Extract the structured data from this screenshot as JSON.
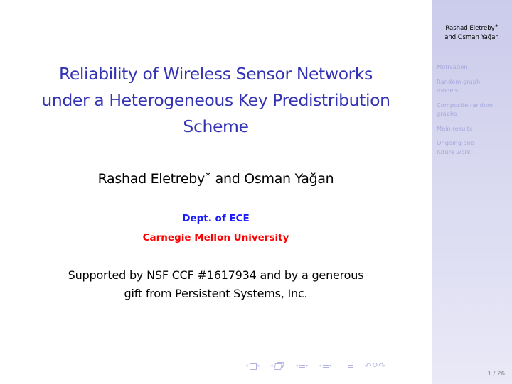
{
  "slide": {
    "title_lines": [
      "Reliability of Wireless Sensor Networks",
      "under a Heterogeneous Key Predistribution",
      "Scheme"
    ],
    "authors": {
      "first": "Rashad Eletreby",
      "first_mark": "∗",
      "connector": " and ",
      "second": "Osman Yağan"
    },
    "department": "Dept. of ECE",
    "university": "Carnegie Mellon University",
    "support_lines": [
      "Supported by NSF CCF #1617934 and by a generous",
      "gift from Persistent Systems, Inc."
    ],
    "colors": {
      "title": "#3333b3",
      "department": "#1a1aff",
      "university": "#ff0000"
    }
  },
  "sidebar": {
    "author_line1": "Rashad Eletreby",
    "author_mark": "∗",
    "author_line2": "and Osman Yağan",
    "items": [
      {
        "label": "Motivation"
      },
      {
        "label": "Random graph models"
      },
      {
        "label": "Composite random graphs"
      },
      {
        "label": "Main results"
      },
      {
        "label": "Ongoing and future work"
      }
    ],
    "page": "1 / 26"
  },
  "navigation": {
    "icons": [
      "frame-nav-icon",
      "subsection-nav-icon",
      "section-nav-icon",
      "subsection-list-nav-icon",
      "toc-icon",
      "back-icon",
      "search-icon",
      "forward-icon"
    ],
    "left_arrow": "◂",
    "right_arrow": "▸",
    "back_glyph": "↶",
    "search_glyph": "⚲",
    "forward_glyph": "↷"
  }
}
